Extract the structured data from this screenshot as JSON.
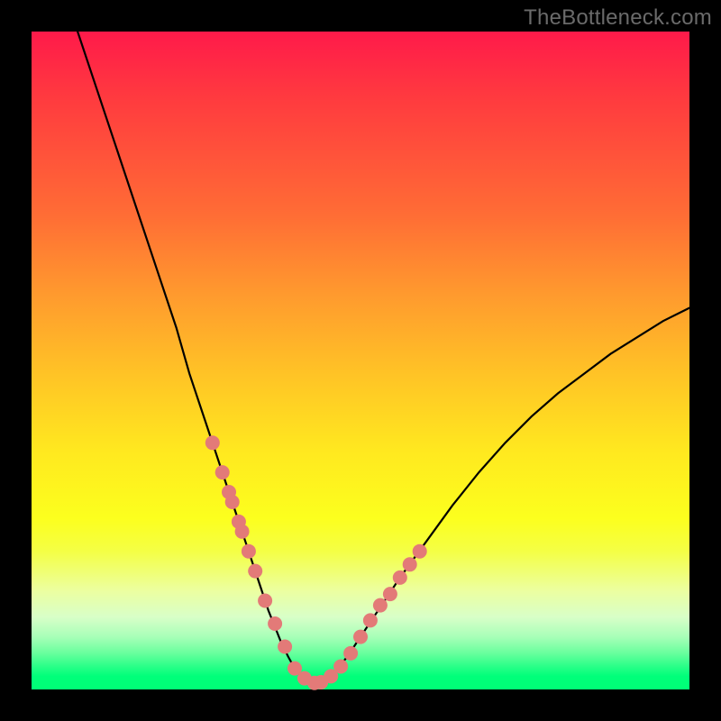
{
  "watermark": "TheBottleneck.com",
  "chart_data": {
    "type": "line",
    "title": "",
    "xlabel": "",
    "ylabel": "",
    "xlim": [
      0,
      100
    ],
    "ylim": [
      0,
      100
    ],
    "grid": false,
    "series": [
      {
        "name": "curve",
        "color": "#000000",
        "x": [
          7,
          10,
          13,
          16,
          19,
          22,
          24,
          26,
          28,
          30,
          31,
          32,
          33,
          34,
          35,
          36,
          37,
          38,
          39,
          40,
          41,
          42,
          43,
          44,
          46,
          48,
          50,
          53,
          56,
          60,
          64,
          68,
          72,
          76,
          80,
          84,
          88,
          92,
          96,
          100
        ],
        "y": [
          100,
          91,
          82,
          73,
          64,
          55,
          48,
          42,
          36,
          30,
          27,
          24,
          21,
          18,
          15,
          12,
          9.5,
          7,
          5,
          3.2,
          2,
          1.2,
          1,
          1.2,
          2.5,
          5,
          8,
          12.5,
          17,
          22.5,
          28,
          33,
          37.5,
          41.5,
          45,
          48,
          51,
          53.5,
          56,
          58
        ]
      }
    ],
    "points": {
      "name": "highlighted-dots",
      "color": "#e37a78",
      "radius": 1.1,
      "x": [
        27.5,
        29,
        30,
        30.5,
        31.5,
        32,
        33,
        34,
        35.5,
        37,
        38.5,
        40,
        41.5,
        43,
        44,
        45.5,
        47,
        48.5,
        50,
        51.5,
        53,
        54.5,
        56,
        57.5,
        59
      ],
      "y": [
        37.5,
        33,
        30,
        28.5,
        25.5,
        24,
        21,
        18,
        13.5,
        10,
        6.5,
        3.2,
        1.7,
        1.0,
        1.1,
        2.0,
        3.5,
        5.5,
        8,
        10.5,
        12.8,
        14.5,
        17,
        19,
        21
      ]
    }
  }
}
